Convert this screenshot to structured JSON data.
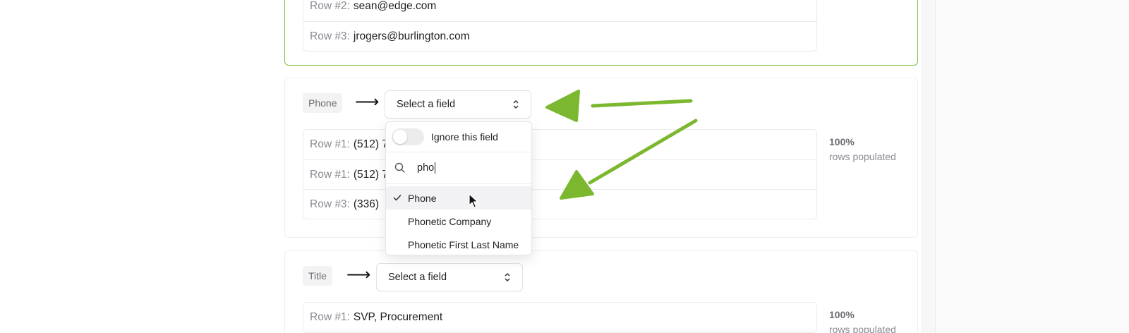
{
  "email_card": {
    "rows": [
      {
        "label": "Row #2:",
        "value": "sean@edge.com"
      },
      {
        "label": "Row #3:",
        "value": "jrogers@burlington.com"
      }
    ]
  },
  "phone_card": {
    "column": "Phone",
    "arrow": "⟶",
    "select_label": "Select a field",
    "rows": [
      {
        "label": "Row #1:",
        "value": "(512) 7"
      },
      {
        "label": "Row #1:",
        "value": "(512) 7"
      },
      {
        "label": "Row #3:",
        "value": "(336)"
      }
    ],
    "stats": {
      "percent": "100%",
      "label": "rows populated"
    }
  },
  "dropdown": {
    "toggle_label": "Ignore this field",
    "search_value": "pho",
    "options": [
      {
        "label": "Phone",
        "selected": true
      },
      {
        "label": "Phonetic Company",
        "selected": false
      },
      {
        "label": "Phonetic First Last Name",
        "selected": false
      }
    ]
  },
  "title_card": {
    "column": "Title",
    "arrow": "⟶",
    "select_label": "Select a field",
    "rows": [
      {
        "label": "Row #1:",
        "value": "SVP, Procurement"
      }
    ],
    "stats": {
      "percent": "100%",
      "label": "rows populated"
    }
  },
  "colors": {
    "accent_green": "#7cb82f",
    "card_active_border": "#7fbf3f"
  }
}
